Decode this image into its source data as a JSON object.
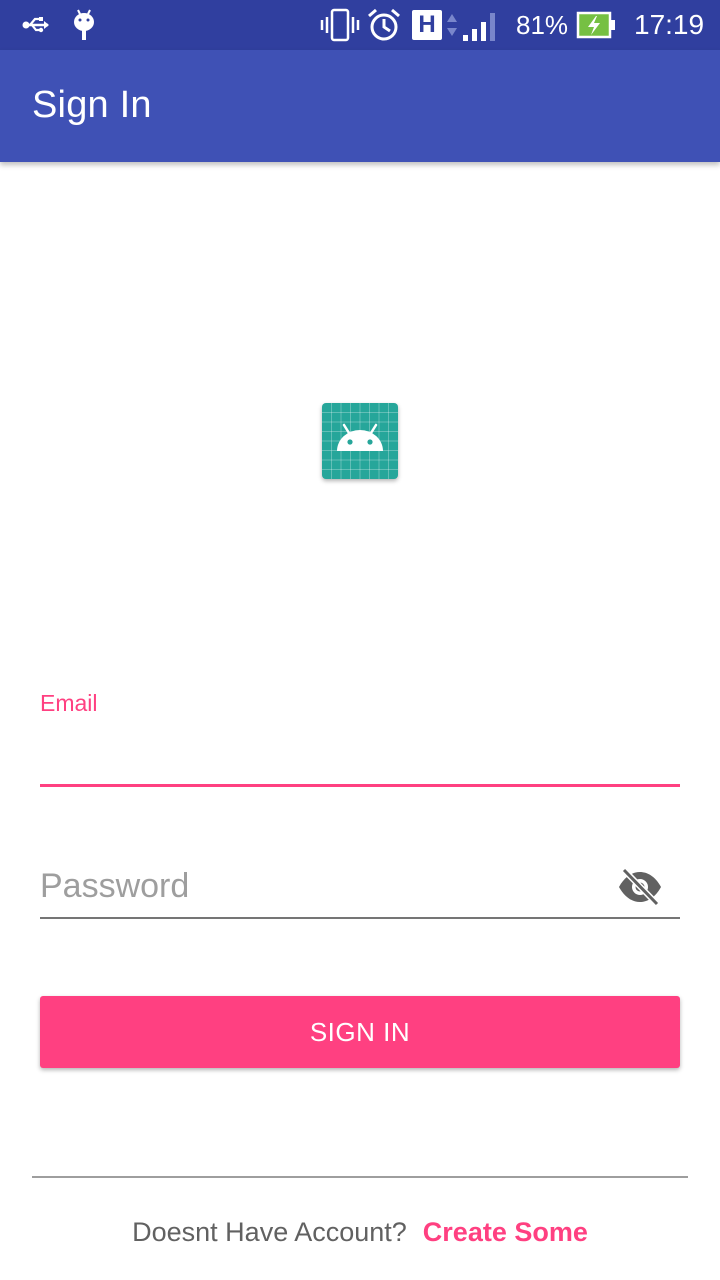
{
  "status_bar": {
    "battery_percent": "81%",
    "time": "17:19",
    "network_type": "H",
    "icons": [
      "usb-icon",
      "android-debug-icon",
      "vibrate-icon",
      "alarm-icon",
      "network-h-icon",
      "signal-icon",
      "battery-charging-icon"
    ]
  },
  "app_bar": {
    "title": "Sign In"
  },
  "logo": {
    "icon": "android-logo-icon"
  },
  "form": {
    "email_label": "Email",
    "email_value": "",
    "password_placeholder": "Password",
    "password_value": "",
    "visibility_icon": "visibility-off-icon",
    "submit_label": "SIGN IN"
  },
  "footer": {
    "prompt": "Doesnt Have Account?",
    "link_label": "Create Some"
  },
  "colors": {
    "status_bar": "#303F9F",
    "primary": "#3F51B5",
    "accent": "#FF4081",
    "logo_bg": "#26A69A"
  }
}
